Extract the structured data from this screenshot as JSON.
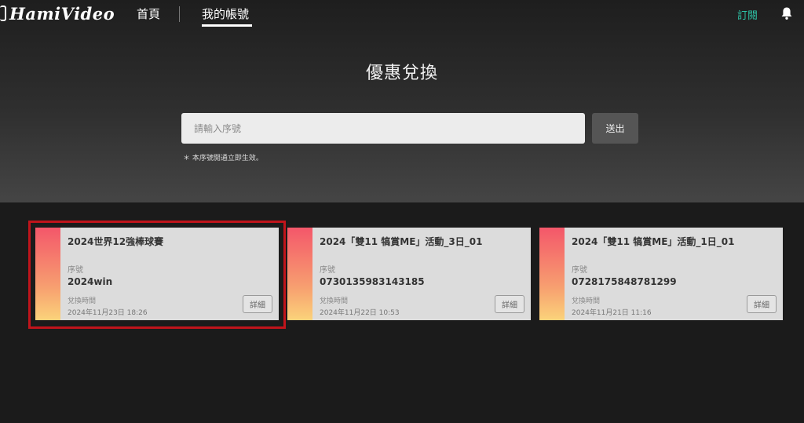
{
  "header": {
    "logo_text": "HamiVideo",
    "nav": [
      {
        "label": "首頁",
        "active": false
      },
      {
        "label": "我的帳號",
        "active": true
      }
    ],
    "subscribe_label": "訂閱",
    "bell_icon": "bell-icon",
    "accent_color": "#2ec5a8"
  },
  "redeem": {
    "title": "優惠兌換",
    "input_placeholder": "請輸入序號",
    "input_value": "",
    "submit_label": "送出",
    "hint": "＊ 本序號開通立即生效。"
  },
  "cards": [
    {
      "title": "2024世界12強棒球賽",
      "serial_label": "序號",
      "serial": "2024win",
      "time_label": "兌換時間",
      "time": "2024年11月23日 18:26",
      "detail_label": "詳細",
      "highlighted": true
    },
    {
      "title": "2024「雙11 犒賞ME」活動_3日_01",
      "serial_label": "序號",
      "serial": "0730135983143185",
      "time_label": "兌換時間",
      "time": "2024年11月22日 10:53",
      "detail_label": "詳細",
      "highlighted": false
    },
    {
      "title": "2024「雙11 犒賞ME」活動_1日_01",
      "serial_label": "序號",
      "serial": "0728175848781299",
      "time_label": "兌換時間",
      "time": "2024年11月21日 11:16",
      "detail_label": "詳細",
      "highlighted": false
    }
  ],
  "colors": {
    "highlight_border": "#c0141b",
    "card_gradient_top": "#f4576a",
    "card_gradient_bottom": "#fbd37a"
  }
}
